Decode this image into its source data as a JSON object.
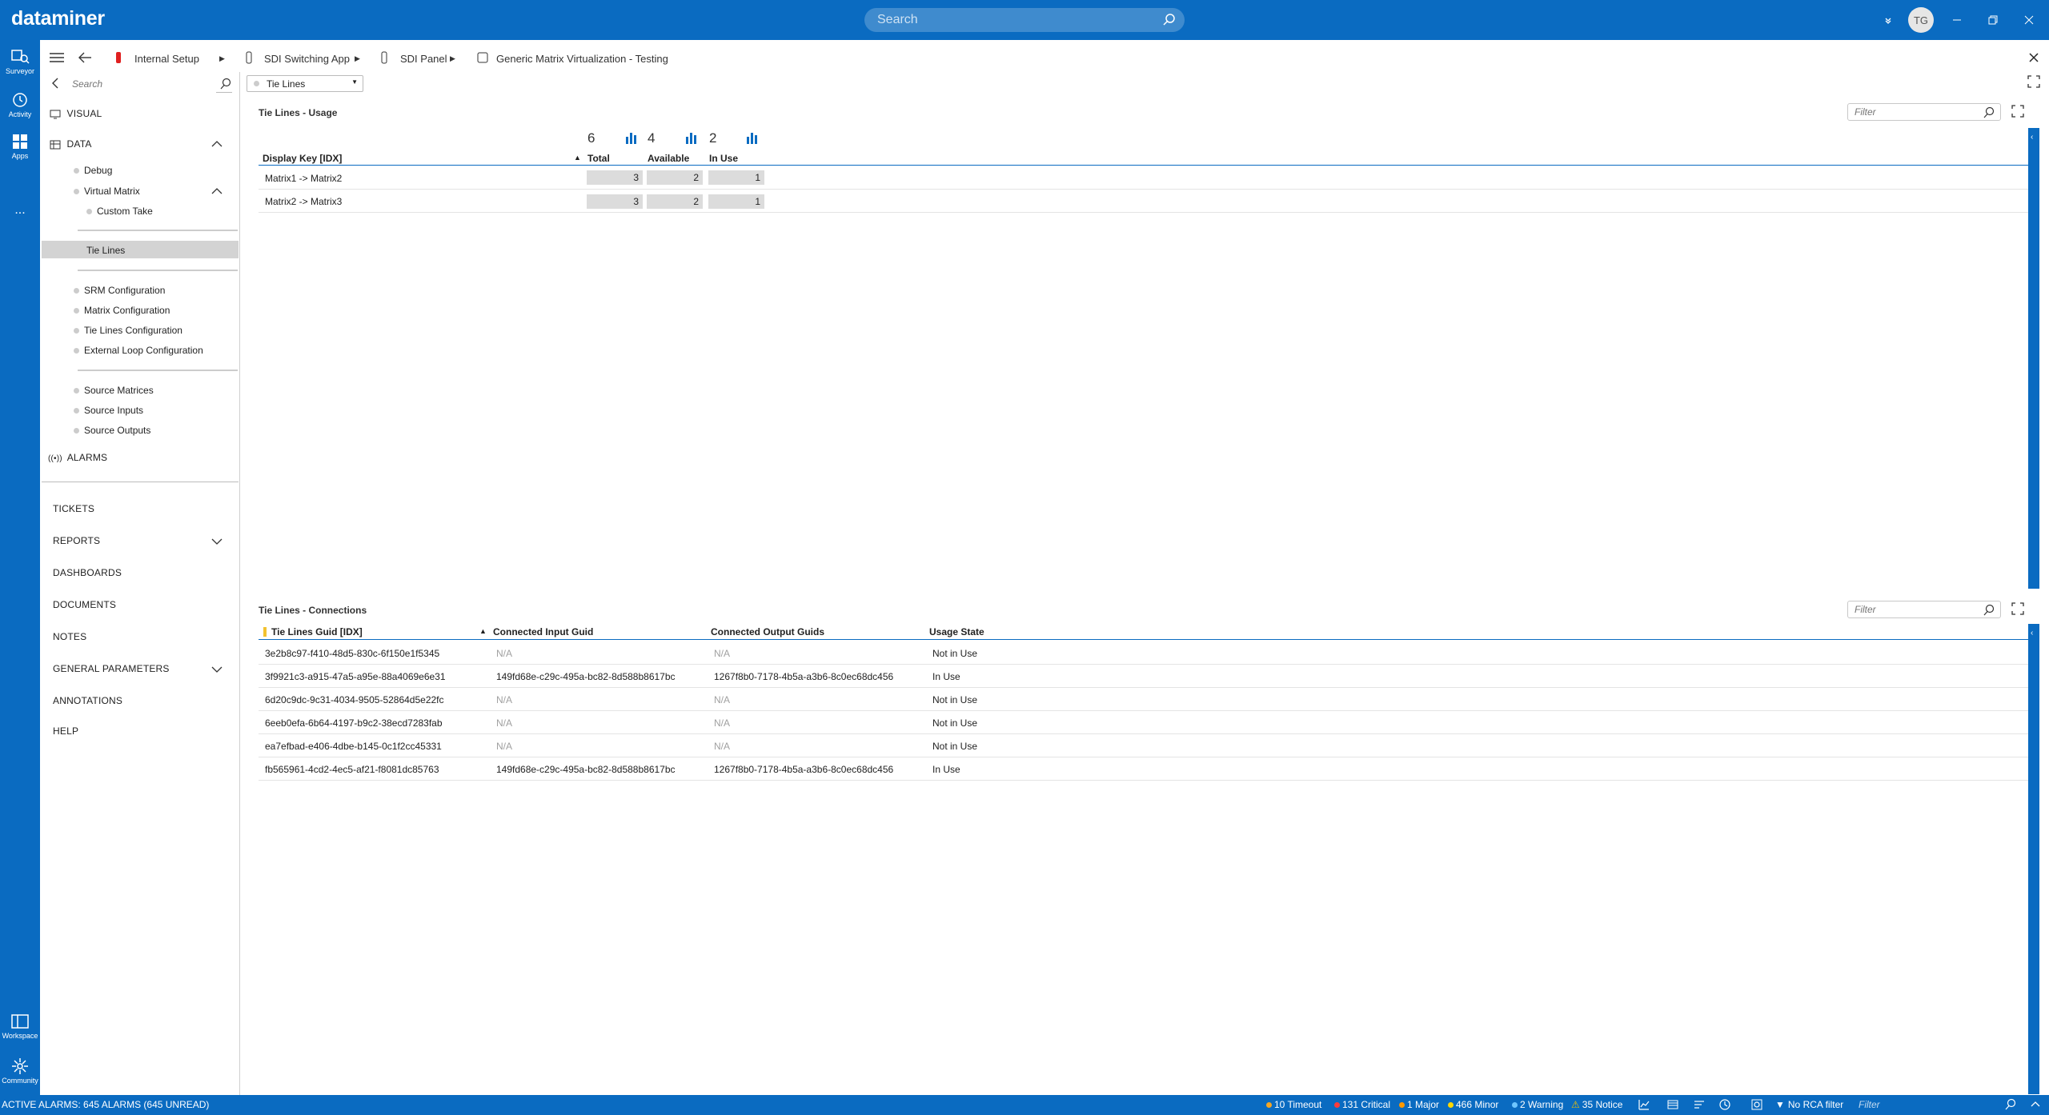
{
  "app": {
    "logo": "dataminer",
    "search_placeholder": "Search",
    "user_initials": "TG"
  },
  "rail": {
    "items": [
      {
        "label": "Surveyor",
        "icon": "surveyor-icon"
      },
      {
        "label": "Activity",
        "icon": "clock-icon"
      },
      {
        "label": "Apps",
        "icon": "apps-icon"
      },
      {
        "label": "...",
        "icon": "more-icon"
      },
      {
        "label": "Workspace",
        "icon": "workspace-icon"
      },
      {
        "label": "Community",
        "icon": "community-icon"
      }
    ]
  },
  "breadcrumb": {
    "items": [
      "Internal Setup",
      "SDI Switching App",
      "SDI Panel",
      "Generic Matrix Virtualization - Testing"
    ]
  },
  "page_selector": {
    "value": "Tie Lines"
  },
  "sidebar": {
    "search_placeholder": "Search",
    "visual": "VISUAL",
    "data": "DATA",
    "items": [
      "Debug",
      "Virtual Matrix",
      "Custom Take",
      "Tie Lines",
      "SRM Configuration",
      "Matrix Configuration",
      "Tie Lines Configuration",
      "External Loop Configuration",
      "Source Matrices",
      "Source Inputs",
      "Source Outputs"
    ],
    "alarms": "ALARMS",
    "main": [
      "TICKETS",
      "REPORTS",
      "DASHBOARDS",
      "DOCUMENTS",
      "NOTES",
      "GENERAL PARAMETERS",
      "ANNOTATIONS",
      "HELP"
    ]
  },
  "usage": {
    "title": "Tie Lines - Usage",
    "filter_placeholder": "Filter",
    "stats": {
      "total": "6",
      "available": "4",
      "in_use": "2"
    },
    "headers": [
      "Display Key [IDX]",
      "Total",
      "Available",
      "In Use"
    ],
    "rows": [
      {
        "key": "Matrix1 -> Matrix2",
        "total": "3",
        "available": "2",
        "in_use": "1"
      },
      {
        "key": "Matrix2 -> Matrix3",
        "total": "3",
        "available": "2",
        "in_use": "1"
      }
    ]
  },
  "connections": {
    "title": "Tie Lines - Connections",
    "filter_placeholder": "Filter",
    "headers": [
      "Tie Lines Guid [IDX]",
      "Connected Input Guid",
      "Connected Output Guids",
      "Usage State"
    ],
    "rows": [
      {
        "guid": "3e2b8c97-f410-48d5-830c-6f150e1f5345",
        "input": "N/A",
        "output": "N/A",
        "state": "Not in Use"
      },
      {
        "guid": "3f9921c3-a915-47a5-a95e-88a4069e6e31",
        "input": "149fd68e-c29c-495a-bc82-8d588b8617bc",
        "output": "1267f8b0-7178-4b5a-a3b6-8c0ec68dc456",
        "state": "In Use"
      },
      {
        "guid": "6d20c9dc-9c31-4034-9505-52864d5e22fc",
        "input": "N/A",
        "output": "N/A",
        "state": "Not in Use"
      },
      {
        "guid": "6eeb0efa-6b64-4197-b9c2-38ecd7283fab",
        "input": "N/A",
        "output": "N/A",
        "state": "Not in Use"
      },
      {
        "guid": "ea7efbad-e406-4dbe-b145-0c1f2cc45331",
        "input": "N/A",
        "output": "N/A",
        "state": "Not in Use"
      },
      {
        "guid": "fb565961-4cd2-4ec5-af21-f8081dc85763",
        "input": "149fd68e-c29c-495a-bc82-8d588b8617bc",
        "output": "1267f8b0-7178-4b5a-a3b6-8c0ec68dc456",
        "state": "In Use"
      }
    ]
  },
  "status": {
    "active_alarms": "ACTIVE ALARMS: 645 ALARMS (645 UNREAD)",
    "timeout": "10 Timeout",
    "critical": "131 Critical",
    "major": "1 Major",
    "minor": "466 Minor",
    "warning": "2 Warning",
    "notice": "35 Notice",
    "rca": "No RCA filter",
    "filter_placeholder": "Filter"
  },
  "colors": {
    "brand": "#0a6bc1",
    "timeout": "#f5a623",
    "critical": "#ff3b3b",
    "major": "#ff9900",
    "minor": "#ffd700",
    "warning": "#6ec6ff",
    "notice": "#f0c000"
  }
}
